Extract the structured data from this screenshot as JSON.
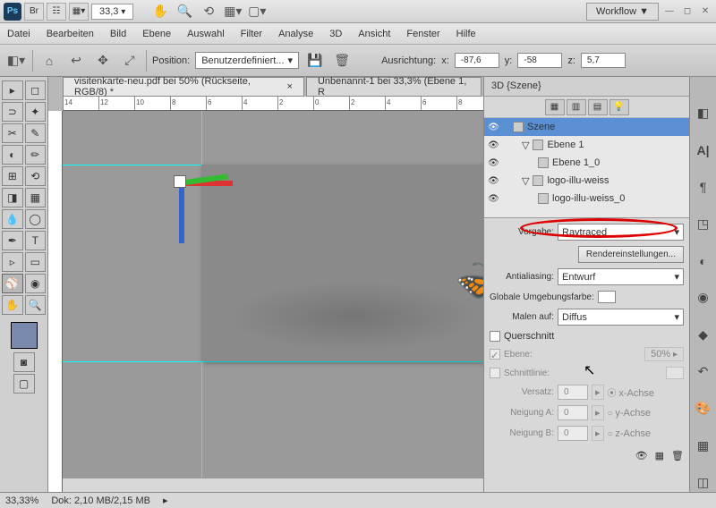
{
  "titlebar": {
    "zoom": "33,3",
    "workflow": "Workflow ▼"
  },
  "menu": [
    "Datei",
    "Bearbeiten",
    "Bild",
    "Ebene",
    "Auswahl",
    "Filter",
    "Analyse",
    "3D",
    "Ansicht",
    "Fenster",
    "Hilfe"
  ],
  "options": {
    "position_label": "Position:",
    "position_value": "Benutzerdefiniert...",
    "ausrichtung": "Ausrichtung:",
    "x_label": "x:",
    "x": "-87,6",
    "y_label": "y:",
    "y": "-58",
    "z_label": "z:",
    "z": "5,7"
  },
  "tabs": [
    {
      "label": "visitenkarte-neu.pdf bei 50% (Rückseite, RGB/8) *",
      "close": "×"
    },
    {
      "label": "Unbenannt-1 bei 33,3% (Ebene 1, R",
      "close": ""
    }
  ],
  "panel": {
    "title": "3D {Szene}",
    "scene": [
      {
        "label": "Szene",
        "indent": 0,
        "sel": true,
        "tri": ""
      },
      {
        "label": "Ebene 1",
        "indent": 1,
        "tri": "▽"
      },
      {
        "label": "Ebene 1_0",
        "indent": 2,
        "tri": ""
      },
      {
        "label": "logo-illu-weiss",
        "indent": 1,
        "tri": "▽"
      },
      {
        "label": "logo-illu-weiss_0",
        "indent": 2,
        "tri": ""
      }
    ],
    "vorgabe_label": "Vorgabe:",
    "vorgabe_value": "Raytraced",
    "render_btn": "Rendereinstellungen...",
    "antialiasing_label": "Antialiasing:",
    "antialiasing_value": "Entwurf",
    "umgebung": "Globale Umgebungsfarbe:",
    "malen_label": "Malen auf:",
    "malen_value": "Diffus",
    "querschnitt": "Querschnitt",
    "ebene": "Ebene:",
    "ebene_pct": "50%",
    "schnittlinie": "Schnittlinie:",
    "versatz": "Versatz:",
    "versatz_v": "0",
    "xachse": "x-Achse",
    "neigung_a": "Neigung A:",
    "neigung_a_v": "0",
    "yachse": "y-Achse",
    "neigung_b": "Neigung B:",
    "neigung_b_v": "0",
    "zachse": "z-Achse"
  },
  "status": {
    "zoom": "33,33%",
    "doc": "Dok: 2,10 MB/2,15 MB"
  },
  "ruler_h": [
    "14",
    "12",
    "10",
    "8",
    "6",
    "4",
    "2",
    "0",
    "2",
    "4",
    "6",
    "8"
  ]
}
